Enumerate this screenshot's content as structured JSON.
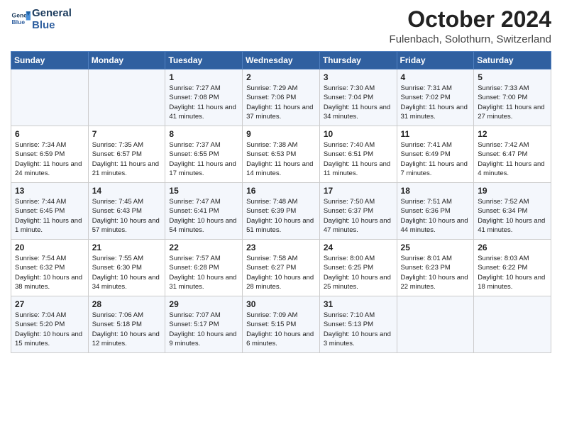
{
  "header": {
    "logo_line1": "General",
    "logo_line2": "Blue",
    "month": "October 2024",
    "location": "Fulenbach, Solothurn, Switzerland"
  },
  "days_of_week": [
    "Sunday",
    "Monday",
    "Tuesday",
    "Wednesday",
    "Thursday",
    "Friday",
    "Saturday"
  ],
  "weeks": [
    [
      {
        "num": "",
        "empty": true
      },
      {
        "num": "",
        "empty": true
      },
      {
        "num": "1",
        "sunrise": "7:27 AM",
        "sunset": "7:08 PM",
        "daylight": "11 hours and 41 minutes."
      },
      {
        "num": "2",
        "sunrise": "7:29 AM",
        "sunset": "7:06 PM",
        "daylight": "11 hours and 37 minutes."
      },
      {
        "num": "3",
        "sunrise": "7:30 AM",
        "sunset": "7:04 PM",
        "daylight": "11 hours and 34 minutes."
      },
      {
        "num": "4",
        "sunrise": "7:31 AM",
        "sunset": "7:02 PM",
        "daylight": "11 hours and 31 minutes."
      },
      {
        "num": "5",
        "sunrise": "7:33 AM",
        "sunset": "7:00 PM",
        "daylight": "11 hours and 27 minutes."
      }
    ],
    [
      {
        "num": "6",
        "sunrise": "7:34 AM",
        "sunset": "6:59 PM",
        "daylight": "11 hours and 24 minutes."
      },
      {
        "num": "7",
        "sunrise": "7:35 AM",
        "sunset": "6:57 PM",
        "daylight": "11 hours and 21 minutes."
      },
      {
        "num": "8",
        "sunrise": "7:37 AM",
        "sunset": "6:55 PM",
        "daylight": "11 hours and 17 minutes."
      },
      {
        "num": "9",
        "sunrise": "7:38 AM",
        "sunset": "6:53 PM",
        "daylight": "11 hours and 14 minutes."
      },
      {
        "num": "10",
        "sunrise": "7:40 AM",
        "sunset": "6:51 PM",
        "daylight": "11 hours and 11 minutes."
      },
      {
        "num": "11",
        "sunrise": "7:41 AM",
        "sunset": "6:49 PM",
        "daylight": "11 hours and 7 minutes."
      },
      {
        "num": "12",
        "sunrise": "7:42 AM",
        "sunset": "6:47 PM",
        "daylight": "11 hours and 4 minutes."
      }
    ],
    [
      {
        "num": "13",
        "sunrise": "7:44 AM",
        "sunset": "6:45 PM",
        "daylight": "11 hours and 1 minute."
      },
      {
        "num": "14",
        "sunrise": "7:45 AM",
        "sunset": "6:43 PM",
        "daylight": "10 hours and 57 minutes."
      },
      {
        "num": "15",
        "sunrise": "7:47 AM",
        "sunset": "6:41 PM",
        "daylight": "10 hours and 54 minutes."
      },
      {
        "num": "16",
        "sunrise": "7:48 AM",
        "sunset": "6:39 PM",
        "daylight": "10 hours and 51 minutes."
      },
      {
        "num": "17",
        "sunrise": "7:50 AM",
        "sunset": "6:37 PM",
        "daylight": "10 hours and 47 minutes."
      },
      {
        "num": "18",
        "sunrise": "7:51 AM",
        "sunset": "6:36 PM",
        "daylight": "10 hours and 44 minutes."
      },
      {
        "num": "19",
        "sunrise": "7:52 AM",
        "sunset": "6:34 PM",
        "daylight": "10 hours and 41 minutes."
      }
    ],
    [
      {
        "num": "20",
        "sunrise": "7:54 AM",
        "sunset": "6:32 PM",
        "daylight": "10 hours and 38 minutes."
      },
      {
        "num": "21",
        "sunrise": "7:55 AM",
        "sunset": "6:30 PM",
        "daylight": "10 hours and 34 minutes."
      },
      {
        "num": "22",
        "sunrise": "7:57 AM",
        "sunset": "6:28 PM",
        "daylight": "10 hours and 31 minutes."
      },
      {
        "num": "23",
        "sunrise": "7:58 AM",
        "sunset": "6:27 PM",
        "daylight": "10 hours and 28 minutes."
      },
      {
        "num": "24",
        "sunrise": "8:00 AM",
        "sunset": "6:25 PM",
        "daylight": "10 hours and 25 minutes."
      },
      {
        "num": "25",
        "sunrise": "8:01 AM",
        "sunset": "6:23 PM",
        "daylight": "10 hours and 22 minutes."
      },
      {
        "num": "26",
        "sunrise": "8:03 AM",
        "sunset": "6:22 PM",
        "daylight": "10 hours and 18 minutes."
      }
    ],
    [
      {
        "num": "27",
        "sunrise": "7:04 AM",
        "sunset": "5:20 PM",
        "daylight": "10 hours and 15 minutes."
      },
      {
        "num": "28",
        "sunrise": "7:06 AM",
        "sunset": "5:18 PM",
        "daylight": "10 hours and 12 minutes."
      },
      {
        "num": "29",
        "sunrise": "7:07 AM",
        "sunset": "5:17 PM",
        "daylight": "10 hours and 9 minutes."
      },
      {
        "num": "30",
        "sunrise": "7:09 AM",
        "sunset": "5:15 PM",
        "daylight": "10 hours and 6 minutes."
      },
      {
        "num": "31",
        "sunrise": "7:10 AM",
        "sunset": "5:13 PM",
        "daylight": "10 hours and 3 minutes."
      },
      {
        "num": "",
        "empty": true
      },
      {
        "num": "",
        "empty": true
      }
    ]
  ],
  "labels": {
    "sunrise": "Sunrise:",
    "sunset": "Sunset:",
    "daylight": "Daylight:"
  }
}
